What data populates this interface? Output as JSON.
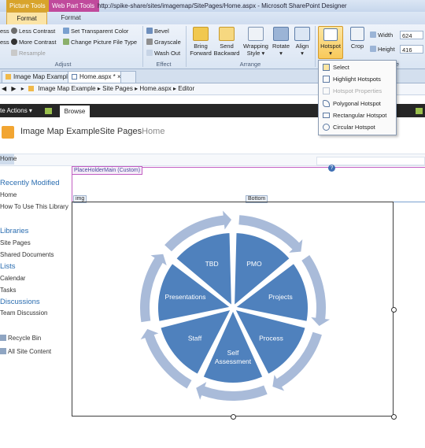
{
  "window": {
    "context_tabs": [
      "Picture Tools",
      "Web Part Tools"
    ],
    "title": "http://spike-share/sites/imagemap/SitePages/Home.aspx - Microsoft SharePoint Designer"
  },
  "ribbon": {
    "tabs": [
      "Format",
      "Format"
    ],
    "adjust": {
      "items": [
        "Less Contrast",
        "More Contrast",
        "Resample",
        "Set Transparent Color",
        "Change Picture File Type"
      ],
      "partial_left": [
        "ess",
        "ess"
      ],
      "label": "Adjust"
    },
    "effect": {
      "items": [
        "Bevel",
        "Grayscale",
        "Wash Out"
      ],
      "label": "Effect"
    },
    "arrange": {
      "items": [
        {
          "line1": "Bring",
          "line2": "Forward"
        },
        {
          "line1": "Send",
          "line2": "Backward"
        },
        {
          "line1": "Wrapping",
          "line2": "Style"
        },
        {
          "line1": "Rotate",
          "line2": ""
        },
        {
          "line1": "Align",
          "line2": ""
        }
      ],
      "label": "Arrange"
    },
    "hotspot_label": "Hotspot",
    "crop_label": "Crop",
    "size": {
      "width_label": "Width",
      "width_value": "624",
      "height_label": "Height",
      "height_value": "416"
    },
    "partial_group_label": "e"
  },
  "hotspot_menu": [
    {
      "label": "Select",
      "enabled": true
    },
    {
      "label": "Highlight Hotspots",
      "enabled": true
    },
    {
      "label": "Hotspot Properties",
      "enabled": false
    },
    {
      "label": "Polygonal Hotspot",
      "enabled": true
    },
    {
      "label": "Rectangular Hotspot",
      "enabled": true
    },
    {
      "label": "Circular Hotspot",
      "enabled": true
    }
  ],
  "doc_tabs": [
    "Image Map Example",
    "Home.aspx *"
  ],
  "breadcrumb": [
    "Image Map Example",
    "Site Pages",
    "Home.aspx",
    "Editor"
  ],
  "sharepoint": {
    "site_actions": "te Actions",
    "browse_tab": "Browse",
    "title_main": "Image Map ExampleSite Pages",
    "title_page": "Home",
    "top_home": "Home",
    "quicklaunch": {
      "recently_modified": "Recently Modified",
      "recent_items": [
        "Home",
        "How To Use This Library"
      ],
      "libraries": "Libraries",
      "library_items": [
        "Site Pages",
        "Shared Documents"
      ],
      "lists": "Lists",
      "list_items": [
        "Calendar",
        "Tasks"
      ],
      "discussions": "Discussions",
      "discussion_items": [
        "Team Discussion"
      ],
      "recycle_bin": "Recycle Bin",
      "all_site_content": "All Site Content"
    },
    "placeholder_label": "PlaceHolderMain (Custom)",
    "img_tag": "img",
    "bottom_tag": "Bottom"
  },
  "diagram": {
    "segments": [
      "TBD",
      "PMO",
      "Projects",
      "Process",
      "Self Assessment",
      "Staff",
      "Presentations"
    ],
    "segment_color": "#4f81bd",
    "arrow_color": "#a9bbd9"
  }
}
